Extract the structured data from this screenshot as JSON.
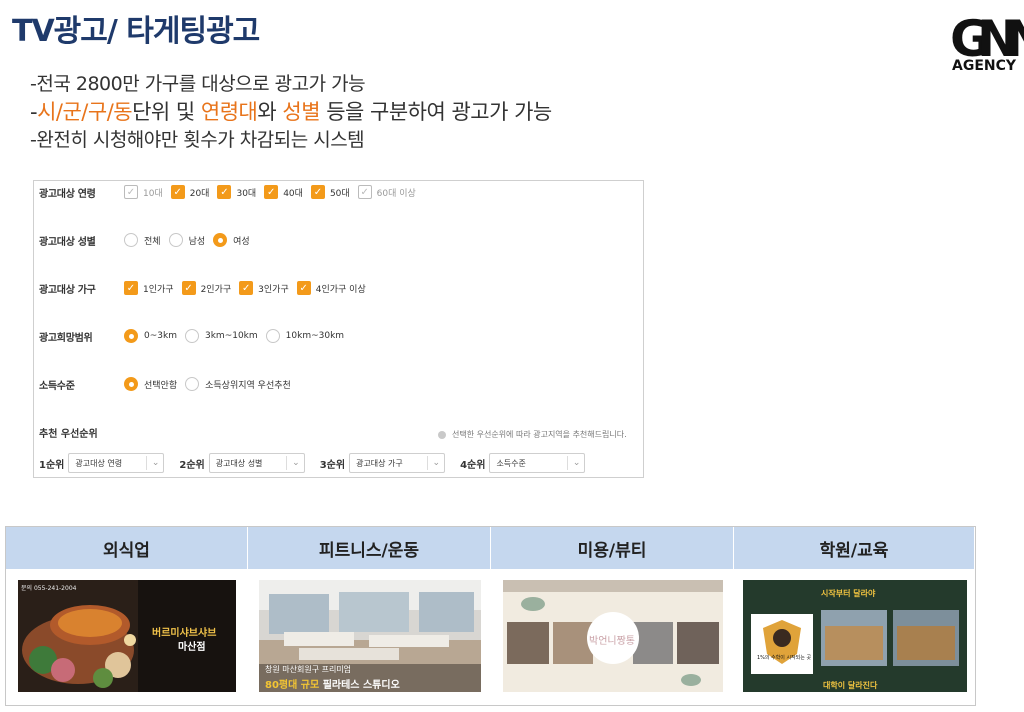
{
  "header": {
    "title": "TV광고/ 타게팅광고",
    "logo": {
      "mark": "GNN",
      "sub": "AGENCY",
      "icon": "gnn-logo"
    }
  },
  "bullets": {
    "b1": "-전국 2800만 가구를 대상으로 광고가 가능",
    "b2": {
      "dash": "-",
      "p1": "시/군/구/동",
      "p2": "단위 및 ",
      "p3": "연령대",
      "p4": "와 ",
      "p5": "성별",
      "p6": " 등을 구분하여 광고가 가능"
    },
    "b3": "-완전히 시청해야만 횟수가 차감되는 시스템"
  },
  "form": {
    "age": {
      "label": "광고대상 연령",
      "options": [
        {
          "text": "10대",
          "checked": false
        },
        {
          "text": "20대",
          "checked": true
        },
        {
          "text": "30대",
          "checked": true
        },
        {
          "text": "40대",
          "checked": true
        },
        {
          "text": "50대",
          "checked": true
        },
        {
          "text": "60대 이상",
          "checked": false
        }
      ]
    },
    "gender": {
      "label": "광고대상 성별",
      "options": [
        {
          "text": "전체",
          "selected": false
        },
        {
          "text": "남성",
          "selected": false
        },
        {
          "text": "여성",
          "selected": true
        }
      ]
    },
    "household": {
      "label": "광고대상 가구",
      "options": [
        {
          "text": "1인가구",
          "checked": true
        },
        {
          "text": "2인가구",
          "checked": true
        },
        {
          "text": "3인가구",
          "checked": true
        },
        {
          "text": "4인가구 이상",
          "checked": true
        }
      ]
    },
    "range": {
      "label": "광고희망범위",
      "options": [
        {
          "text": "0~3km",
          "selected": true
        },
        {
          "text": "3km~10km",
          "selected": false
        },
        {
          "text": "10km~30km",
          "selected": false
        }
      ]
    },
    "income": {
      "label": "소득수준",
      "options": [
        {
          "text": "선택안함",
          "selected": true
        },
        {
          "text": "소득상위지역 우선추천",
          "selected": false
        }
      ]
    },
    "priority": {
      "title": "추천 우선순위",
      "note": "선택한 우선순위에 따라 광고지역을 추천해드립니다.",
      "items": [
        {
          "label": "1순위",
          "value": "광고대상 연령"
        },
        {
          "label": "2순위",
          "value": "광고대상 성별"
        },
        {
          "label": "3순위",
          "value": "광고대상 가구"
        },
        {
          "label": "4순위",
          "value": "소득수준"
        }
      ]
    }
  },
  "categories": [
    {
      "name": "외식업",
      "thumb": {
        "phone": "문의 055-241-2004",
        "headline": "버르미샤브샤브",
        "branch": "마산점"
      }
    },
    {
      "name": "피트니스/운동",
      "thumb": {
        "line1": "창원 마산회원구 프리미엄",
        "line2a": "80평대 규모",
        "line2b": "필라테스 스튜디오"
      }
    },
    {
      "name": "미용/뷰티",
      "thumb": {
        "brand": "박언니짱통"
      }
    },
    {
      "name": "학원/교육",
      "thumb": {
        "top": "시작부터 달라야",
        "badge": "1%의 수학이 시작되는 곳",
        "bottom": "대학이 달라진다"
      }
    }
  ],
  "colors": {
    "title": "#1f3a6b",
    "accent": "#e8741b",
    "check": "#f39a1a",
    "cat_header": "#c5d7ee"
  }
}
